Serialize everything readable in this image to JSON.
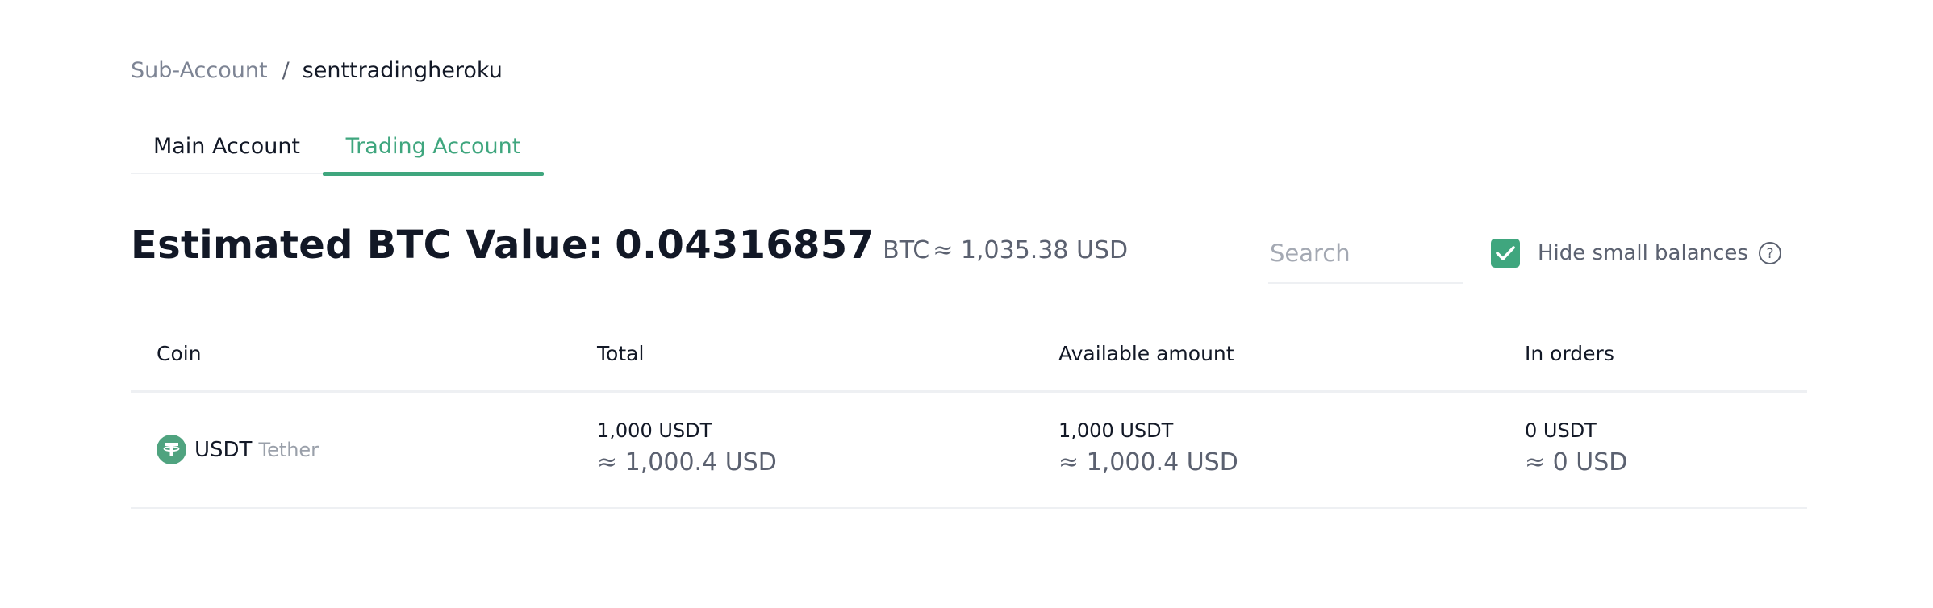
{
  "breadcrumb": {
    "parent": "Sub-Account",
    "separator": "/",
    "current": "senttradingheroku"
  },
  "tabs": [
    {
      "label": "Main Account",
      "active": false
    },
    {
      "label": "Trading Account",
      "active": true
    }
  ],
  "estimate": {
    "label": "Estimated BTC Value:",
    "value": "0.04316857",
    "unit": "BTC",
    "usd": "≈ 1,035.38 USD"
  },
  "search": {
    "placeholder": "Search",
    "value": ""
  },
  "hide_small": {
    "label": "Hide small balances",
    "checked": true,
    "checkbox_icon": "check-icon",
    "help_icon": "question-circle-icon"
  },
  "table": {
    "headers": [
      "Coin",
      "Total",
      "Available amount",
      "In orders"
    ],
    "rows": [
      {
        "coin_icon": "tether-icon",
        "symbol": "USDT",
        "name": "Tether",
        "total": "1,000 USDT",
        "total_usd": "≈ 1,000.4 USD",
        "available": "1,000 USDT",
        "available_usd": "≈ 1,000.4 USD",
        "in_orders": "0 USDT",
        "in_orders_usd": "≈ 0 USD"
      }
    ]
  },
  "colors": {
    "accent": "#3fa67e",
    "tether": "#4fa37f",
    "text_primary": "#121826",
    "text_secondary": "#5b6170",
    "divider": "#eef0f3"
  }
}
